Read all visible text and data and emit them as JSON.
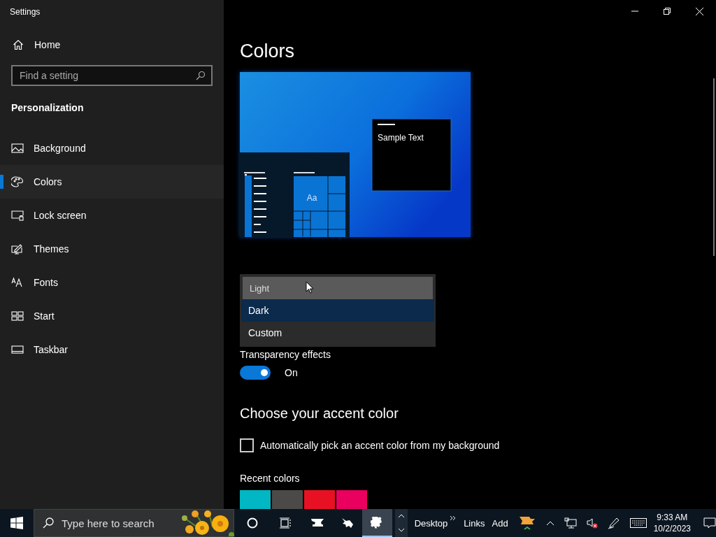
{
  "window": {
    "title": "Settings"
  },
  "sidebar": {
    "home": "Home",
    "search": {
      "placeholder": "Find a setting"
    },
    "section": "Personalization",
    "items": [
      {
        "label": "Background",
        "selected": false
      },
      {
        "label": "Colors",
        "selected": true
      },
      {
        "label": "Lock screen",
        "selected": false
      },
      {
        "label": "Themes",
        "selected": false
      },
      {
        "label": "Fonts",
        "selected": false
      },
      {
        "label": "Start",
        "selected": false
      },
      {
        "label": "Taskbar",
        "selected": false
      }
    ]
  },
  "page": {
    "title": "Colors",
    "preview": {
      "sample_text": "Sample Text",
      "tile_text": "Aa"
    },
    "mode_dropdown": {
      "options": [
        {
          "label": "Light",
          "hovered": true,
          "selected": false
        },
        {
          "label": "Dark",
          "hovered": false,
          "selected": true
        },
        {
          "label": "Custom",
          "hovered": false,
          "selected": false
        }
      ]
    },
    "transparency": {
      "label": "Transparency effects",
      "on": true,
      "state_text": "On"
    },
    "accent": {
      "heading": "Choose your accent color",
      "auto_pick": {
        "label": "Automatically pick an accent color from my background",
        "checked": false
      },
      "recent_label": "Recent colors",
      "recent_colors": [
        {
          "color": "#00b7c3"
        },
        {
          "color": "#4c4a48"
        },
        {
          "color": "#e81123"
        },
        {
          "color": "#ea005e"
        }
      ]
    }
  },
  "taskbar": {
    "search_placeholder": "Type here to search",
    "apps": [
      {
        "selected": false
      },
      {
        "selected": false
      },
      {
        "selected": true
      }
    ],
    "toolbar": [
      "Desktop",
      "Links",
      "Add"
    ],
    "time": "9:33 AM",
    "date": "10/2/2023"
  }
}
